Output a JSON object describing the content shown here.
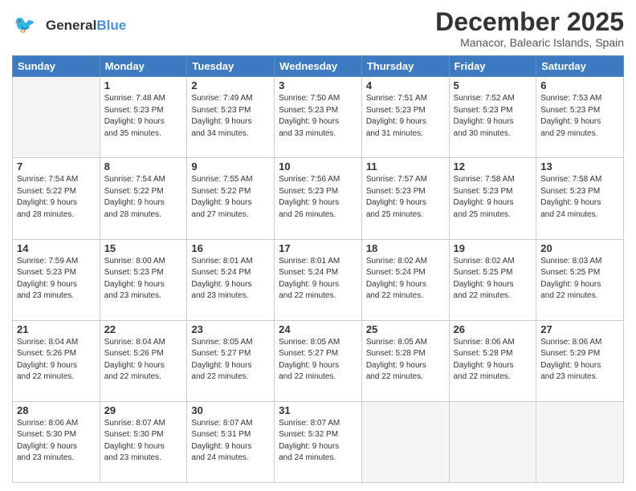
{
  "header": {
    "logo_general": "General",
    "logo_blue": "Blue",
    "month_title": "December 2025",
    "location": "Manacor, Balearic Islands, Spain"
  },
  "weekdays": [
    "Sunday",
    "Monday",
    "Tuesday",
    "Wednesday",
    "Thursday",
    "Friday",
    "Saturday"
  ],
  "weeks": [
    [
      {
        "day": "",
        "info": ""
      },
      {
        "day": "1",
        "info": "Sunrise: 7:48 AM\nSunset: 5:23 PM\nDaylight: 9 hours\nand 35 minutes."
      },
      {
        "day": "2",
        "info": "Sunrise: 7:49 AM\nSunset: 5:23 PM\nDaylight: 9 hours\nand 34 minutes."
      },
      {
        "day": "3",
        "info": "Sunrise: 7:50 AM\nSunset: 5:23 PM\nDaylight: 9 hours\nand 33 minutes."
      },
      {
        "day": "4",
        "info": "Sunrise: 7:51 AM\nSunset: 5:23 PM\nDaylight: 9 hours\nand 31 minutes."
      },
      {
        "day": "5",
        "info": "Sunrise: 7:52 AM\nSunset: 5:23 PM\nDaylight: 9 hours\nand 30 minutes."
      },
      {
        "day": "6",
        "info": "Sunrise: 7:53 AM\nSunset: 5:23 PM\nDaylight: 9 hours\nand 29 minutes."
      }
    ],
    [
      {
        "day": "7",
        "info": "Sunrise: 7:54 AM\nSunset: 5:22 PM\nDaylight: 9 hours\nand 28 minutes."
      },
      {
        "day": "8",
        "info": "Sunrise: 7:54 AM\nSunset: 5:22 PM\nDaylight: 9 hours\nand 28 minutes."
      },
      {
        "day": "9",
        "info": "Sunrise: 7:55 AM\nSunset: 5:22 PM\nDaylight: 9 hours\nand 27 minutes."
      },
      {
        "day": "10",
        "info": "Sunrise: 7:56 AM\nSunset: 5:23 PM\nDaylight: 9 hours\nand 26 minutes."
      },
      {
        "day": "11",
        "info": "Sunrise: 7:57 AM\nSunset: 5:23 PM\nDaylight: 9 hours\nand 25 minutes."
      },
      {
        "day": "12",
        "info": "Sunrise: 7:58 AM\nSunset: 5:23 PM\nDaylight: 9 hours\nand 25 minutes."
      },
      {
        "day": "13",
        "info": "Sunrise: 7:58 AM\nSunset: 5:23 PM\nDaylight: 9 hours\nand 24 minutes."
      }
    ],
    [
      {
        "day": "14",
        "info": "Sunrise: 7:59 AM\nSunset: 5:23 PM\nDaylight: 9 hours\nand 23 minutes."
      },
      {
        "day": "15",
        "info": "Sunrise: 8:00 AM\nSunset: 5:23 PM\nDaylight: 9 hours\nand 23 minutes."
      },
      {
        "day": "16",
        "info": "Sunrise: 8:01 AM\nSunset: 5:24 PM\nDaylight: 9 hours\nand 23 minutes."
      },
      {
        "day": "17",
        "info": "Sunrise: 8:01 AM\nSunset: 5:24 PM\nDaylight: 9 hours\nand 22 minutes."
      },
      {
        "day": "18",
        "info": "Sunrise: 8:02 AM\nSunset: 5:24 PM\nDaylight: 9 hours\nand 22 minutes."
      },
      {
        "day": "19",
        "info": "Sunrise: 8:02 AM\nSunset: 5:25 PM\nDaylight: 9 hours\nand 22 minutes."
      },
      {
        "day": "20",
        "info": "Sunrise: 8:03 AM\nSunset: 5:25 PM\nDaylight: 9 hours\nand 22 minutes."
      }
    ],
    [
      {
        "day": "21",
        "info": "Sunrise: 8:04 AM\nSunset: 5:26 PM\nDaylight: 9 hours\nand 22 minutes."
      },
      {
        "day": "22",
        "info": "Sunrise: 8:04 AM\nSunset: 5:26 PM\nDaylight: 9 hours\nand 22 minutes."
      },
      {
        "day": "23",
        "info": "Sunrise: 8:05 AM\nSunset: 5:27 PM\nDaylight: 9 hours\nand 22 minutes."
      },
      {
        "day": "24",
        "info": "Sunrise: 8:05 AM\nSunset: 5:27 PM\nDaylight: 9 hours\nand 22 minutes."
      },
      {
        "day": "25",
        "info": "Sunrise: 8:05 AM\nSunset: 5:28 PM\nDaylight: 9 hours\nand 22 minutes."
      },
      {
        "day": "26",
        "info": "Sunrise: 8:06 AM\nSunset: 5:28 PM\nDaylight: 9 hours\nand 22 minutes."
      },
      {
        "day": "27",
        "info": "Sunrise: 8:06 AM\nSunset: 5:29 PM\nDaylight: 9 hours\nand 23 minutes."
      }
    ],
    [
      {
        "day": "28",
        "info": "Sunrise: 8:06 AM\nSunset: 5:30 PM\nDaylight: 9 hours\nand 23 minutes."
      },
      {
        "day": "29",
        "info": "Sunrise: 8:07 AM\nSunset: 5:30 PM\nDaylight: 9 hours\nand 23 minutes."
      },
      {
        "day": "30",
        "info": "Sunrise: 8:07 AM\nSunset: 5:31 PM\nDaylight: 9 hours\nand 24 minutes."
      },
      {
        "day": "31",
        "info": "Sunrise: 8:07 AM\nSunset: 5:32 PM\nDaylight: 9 hours\nand 24 minutes."
      },
      {
        "day": "",
        "info": ""
      },
      {
        "day": "",
        "info": ""
      },
      {
        "day": "",
        "info": ""
      }
    ]
  ]
}
